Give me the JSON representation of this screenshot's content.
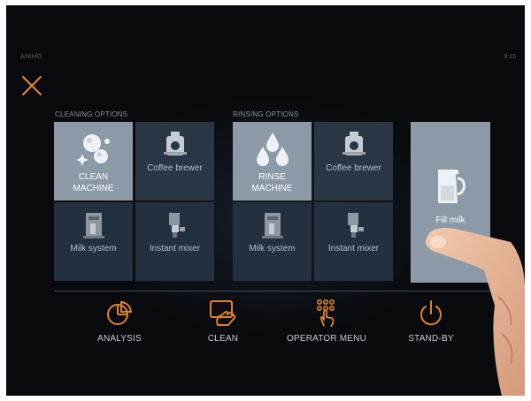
{
  "header": {
    "brand": "ANIMO",
    "time": "9:15"
  },
  "cleaning": {
    "label": "CLEANING OPTIONS",
    "tiles": [
      {
        "label_line1": "CLEAN",
        "label_line2": "MACHINE",
        "icon": "cleaning-bubbles-icon"
      },
      {
        "label": "Coffee brewer",
        "icon": "coffee-brewer-icon"
      },
      {
        "label": "Milk system",
        "icon": "milk-system-icon"
      },
      {
        "label": "Instant mixer",
        "icon": "instant-mixer-icon"
      }
    ]
  },
  "rinsing": {
    "label": "RINSING OPTIONS",
    "tiles": [
      {
        "label_line1": "RINSE",
        "label_line2": "MACHINE",
        "icon": "water-drops-icon"
      },
      {
        "label": "Coffee brewer",
        "icon": "coffee-brewer-icon"
      },
      {
        "label": "Milk system",
        "icon": "milk-system-icon"
      },
      {
        "label": "Instant mixer",
        "icon": "instant-mixer-icon"
      }
    ]
  },
  "fill": {
    "label": "Fill milk",
    "icon": "milk-jug-icon"
  },
  "nav": [
    {
      "label": "ANALYSIS",
      "icon": "pie-chart-icon"
    },
    {
      "label": "CLEAN",
      "icon": "hand-cleaning-icon"
    },
    {
      "label": "OPERATOR MENU",
      "icon": "keypad-touch-icon"
    },
    {
      "label": "STAND-BY",
      "icon": "power-icon"
    }
  ],
  "colors": {
    "accent": "#e0822b",
    "tile": "#2a3644",
    "tile_selected": "#8b9aa6",
    "background": "#080a0d"
  }
}
